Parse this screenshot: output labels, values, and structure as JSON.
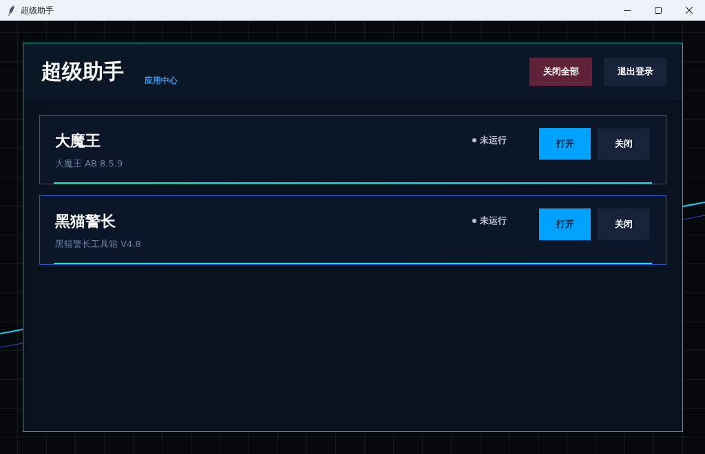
{
  "window": {
    "title": "超级助手"
  },
  "header": {
    "title": "超级助手",
    "subtitle": "应用中心",
    "buttons": [
      {
        "label": "关闭全部",
        "kind": "danger"
      },
      {
        "label": "退出登录",
        "kind": "secondary"
      }
    ]
  },
  "apps": [
    {
      "name": "大魔王",
      "version": "大魔王 AB 8.5.9",
      "status": "未运行",
      "running": false,
      "buttons": [
        {
          "label": "打开",
          "kind": "primary"
        },
        {
          "label": "关闭",
          "kind": "secondary"
        }
      ]
    },
    {
      "name": "黑猫警长",
      "version": "黑猫警长工具箱 V4.8",
      "status": "未运行",
      "running": false,
      "buttons": [
        {
          "label": "打开",
          "kind": "primary"
        },
        {
          "label": "关闭",
          "kind": "secondary"
        }
      ]
    }
  ]
}
